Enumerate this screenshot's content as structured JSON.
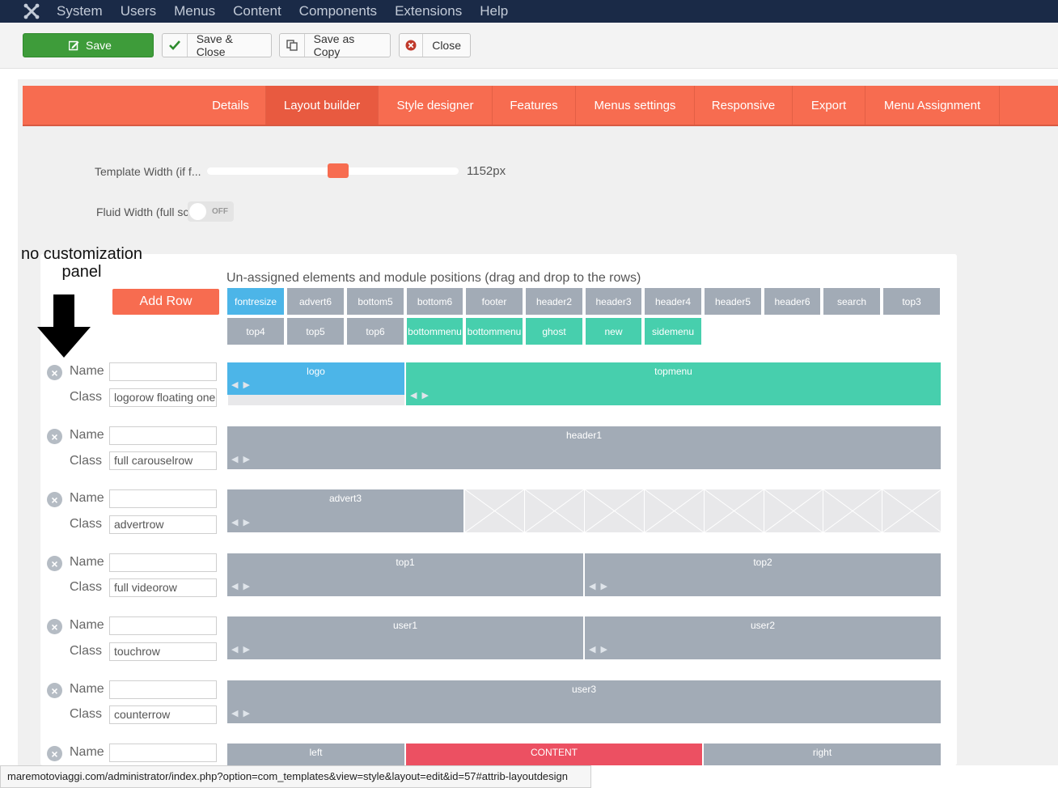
{
  "menubar": {
    "items": [
      "System",
      "Users",
      "Menus",
      "Content",
      "Components",
      "Extensions",
      "Help"
    ]
  },
  "toolbar": {
    "save": "Save",
    "save_close": "Save & Close",
    "save_copy": "Save as Copy",
    "close": "Close"
  },
  "tabs": [
    "Details",
    "Layout builder",
    "Style designer",
    "Features",
    "Menus settings",
    "Responsive",
    "Export",
    "Menu Assignment"
  ],
  "active_tab": "Layout builder",
  "settings": {
    "template_width_label": "Template Width (if f...",
    "template_width_value": "1152px",
    "template_width_fraction": 0.52,
    "fluid_width_label": "Fluid Width (full sc",
    "fluid_toggle": "OFF"
  },
  "annotation": "no customization panel",
  "layout": {
    "unassigned_title": "Un-assigned elements and module positions (drag and drop to the rows)",
    "add_row": "Add Row",
    "unassigned_row1": [
      "fontresize",
      "advert6",
      "bottom5",
      "bottom6",
      "footer",
      "header2",
      "header3",
      "header4",
      "header5",
      "header6",
      "search",
      "top3"
    ],
    "unassigned_row2": [
      "top4",
      "top5",
      "top6",
      "bottommenu",
      "bottommenu",
      "ghost",
      "new",
      "sidemenu"
    ],
    "name_label": "Name",
    "class_label": "Class",
    "rows": [
      {
        "name": "",
        "class": "logorow floating one"
      },
      {
        "name": "",
        "class": "full carouselrow"
      },
      {
        "name": "",
        "class": "advertrow"
      },
      {
        "name": "",
        "class": "full videorow"
      },
      {
        "name": "",
        "class": "touchrow"
      },
      {
        "name": "",
        "class": "counterrow"
      },
      {
        "name": "",
        "class": ""
      }
    ],
    "cells": {
      "logo": "logo",
      "topmenu": "topmenu",
      "header1": "header1",
      "advert3": "advert3",
      "top1": "top1",
      "top2": "top2",
      "user1": "user1",
      "user2": "user2",
      "user3": "user3",
      "left": "left",
      "content": "CONTENT",
      "right": "right"
    }
  },
  "statusbar": {
    "url": "maremotoviaggi.com/administrator/index.php?option=com_templates&view=style&layout=edit&id=57#attrib-layoutdesign"
  },
  "colors": {
    "accent": "#f76c50",
    "menubar": "#1a2a47",
    "save_green": "#3e9c3a",
    "cell_gray": "#a2abb6",
    "cell_blue": "#4cb5e8",
    "cell_teal": "#47cfad",
    "cell_red": "#ec5062"
  }
}
